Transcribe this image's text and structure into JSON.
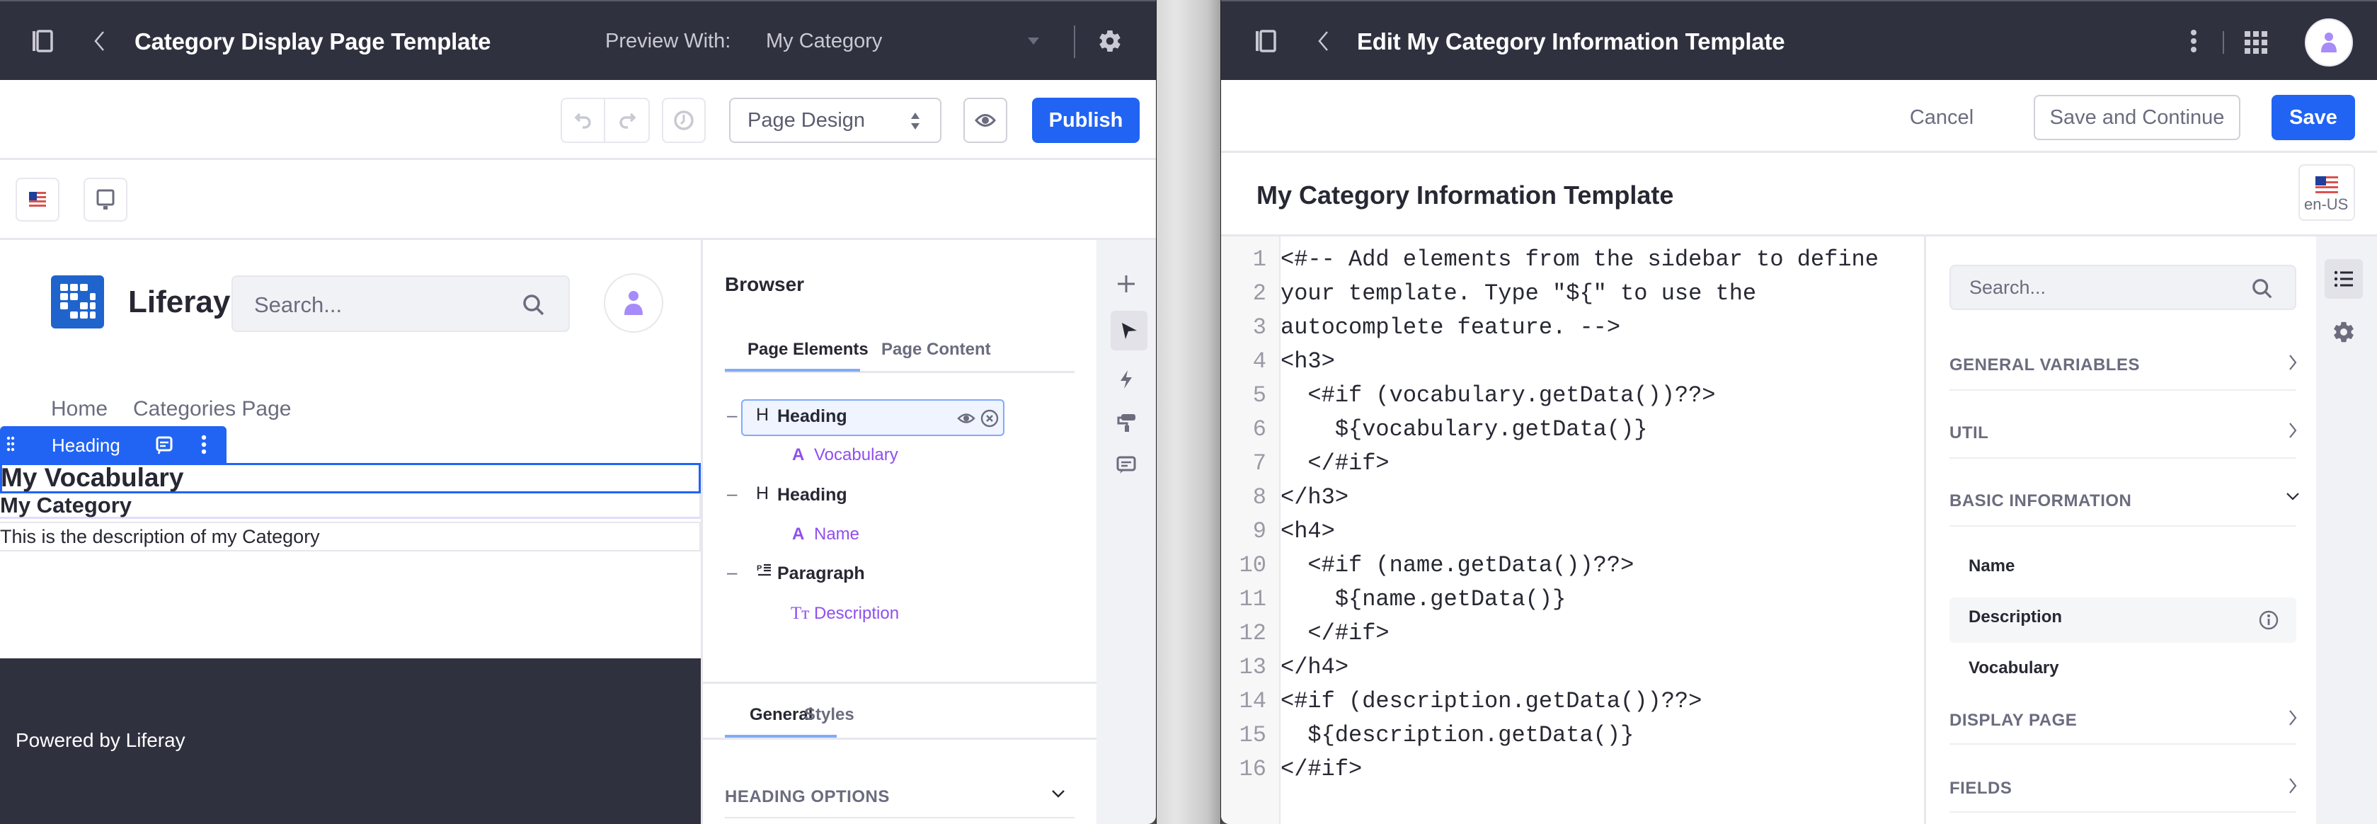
{
  "left_window": {
    "header": {
      "title": "Category Display Page Template",
      "preview_label": "Preview With:",
      "preview_value": "My Category",
      "icons": [
        "sidebar-panel-icon",
        "chevron-left-icon",
        "caret-down-icon",
        "gear-icon"
      ]
    },
    "toolbar": {
      "undo": "undo-icon",
      "redo": "redo-icon",
      "history": "clock-icon",
      "mode_select": "Page Design",
      "preview_icon": "eye-icon",
      "publish_label": "Publish"
    },
    "device_bar": {
      "language_icon": "us-flag-icon",
      "device_icon": "desktop-icon"
    },
    "canvas": {
      "site_name": "Liferay",
      "search_placeholder": "Search...",
      "nav": [
        "Home",
        "Categories Page"
      ],
      "topper_label": "Heading",
      "heading_vocabulary": "My Vocabulary",
      "heading_category": "My Category",
      "paragraph": "This is the description of my Category",
      "footer_text": "Powered by Liferay"
    },
    "browser": {
      "title": "Browser",
      "tabs": [
        {
          "label": "Page Elements",
          "active": true
        },
        {
          "label": "Page Content",
          "active": false
        }
      ],
      "tree": [
        {
          "type": "Heading",
          "icon": "H",
          "selected": true,
          "child": {
            "label": "Vocabulary",
            "icon": "A"
          }
        },
        {
          "type": "Heading",
          "icon": "H",
          "selected": false,
          "child": {
            "label": "Name",
            "icon": "A"
          }
        },
        {
          "type": "Paragraph",
          "icon": "P",
          "selected": false,
          "child": {
            "label": "Description",
            "icon": "Tт"
          }
        }
      ],
      "config_tabs": [
        {
          "label": "General",
          "active": true
        },
        {
          "label": "Styles",
          "active": false
        }
      ],
      "section": "HEADING OPTIONS"
    },
    "side_toolbar": [
      "plus-icon",
      "cursor-icon",
      "bolt-icon",
      "paint-roller-icon",
      "comment-icon"
    ]
  },
  "right_window": {
    "header": {
      "title": "Edit My Category Information Template",
      "icons": [
        "sidebar-panel-icon",
        "chevron-left-icon",
        "kebab-icon",
        "apps-grid-icon",
        "user-avatar-icon"
      ]
    },
    "actions": {
      "cancel_label": "Cancel",
      "save_continue_label": "Save and Continue",
      "save_label": "Save"
    },
    "template_name": "My Category Information Template",
    "locale": "en-US",
    "code_lines": [
      {
        "n": "1",
        "text": "<#-- Add elements from the sidebar to define"
      },
      {
        "n": "2",
        "text": "your template. Type \"${\" to use the"
      },
      {
        "n": "3",
        "text": "autocomplete feature. -->"
      },
      {
        "n": "4",
        "text": "<h3>"
      },
      {
        "n": "5",
        "text": "  <#if (vocabulary.getData())??>"
      },
      {
        "n": "6",
        "text": "    ${vocabulary.getData()}"
      },
      {
        "n": "7",
        "text": "  </#if>"
      },
      {
        "n": "8",
        "text": "</h3>"
      },
      {
        "n": "9",
        "text": "<h4>"
      },
      {
        "n": "10",
        "text": "  <#if (name.getData())??>"
      },
      {
        "n": "11",
        "text": "    ${name.getData()}"
      },
      {
        "n": "12",
        "text": "  </#if>"
      },
      {
        "n": "13",
        "text": "</h4>"
      },
      {
        "n": "14",
        "text": "<#if (description.getData())??>"
      },
      {
        "n": "15",
        "text": "  ${description.getData()}"
      },
      {
        "n": "16",
        "text": "</#if>"
      }
    ],
    "sidebar": {
      "search_placeholder": "Search...",
      "sections": [
        {
          "label": "GENERAL VARIABLES",
          "expanded": false
        },
        {
          "label": "UTIL",
          "expanded": false
        },
        {
          "label": "BASIC INFORMATION",
          "expanded": true,
          "items": [
            "Name",
            "Description",
            "Vocabulary"
          ]
        },
        {
          "label": "DISPLAY PAGE",
          "expanded": false
        },
        {
          "label": "FIELDS",
          "expanded": false
        }
      ],
      "hovered_item": "Description"
    },
    "side_toolbar": [
      "list-icon",
      "gear-icon"
    ]
  },
  "colors": {
    "header_bg": "#30313f",
    "primary": "#2164f3",
    "purple": "#8f4fee",
    "text": "#272833",
    "muted": "#6b6c7e"
  }
}
